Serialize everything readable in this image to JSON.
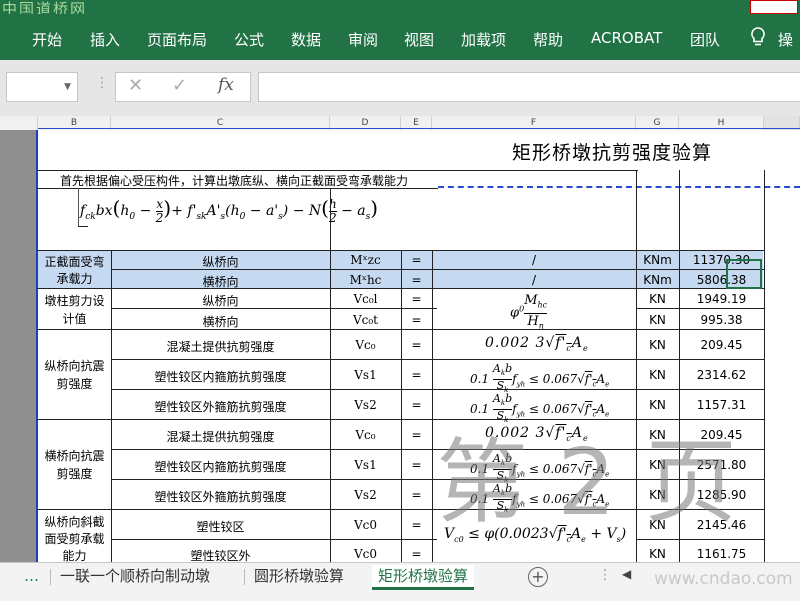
{
  "watermark_top": "中国道桥网",
  "ribbon": {
    "tabs": [
      "开始",
      "插入",
      "页面布局",
      "公式",
      "数据",
      "审阅",
      "视图",
      "加载项",
      "帮助",
      "ACROBAT",
      "团队",
      "操"
    ]
  },
  "formula_bar": {
    "cancel": "✕",
    "confirm": "✓",
    "fx": "fx"
  },
  "columns": [
    "B",
    "C",
    "D",
    "E",
    "F",
    "G",
    "H"
  ],
  "sheet": {
    "title": "矩形桥墩抗剪强度验算",
    "note": "首先根据偏心受压构件，计算出墩底纵、横向正截面受弯承载能力",
    "rows": [
      {
        "group": "正截面受弯承载力",
        "label": "纵桥向",
        "sym": "Mˣzc",
        "eq": "=",
        "f": "/",
        "unit": "KNm",
        "value": "11370.30"
      },
      {
        "group": "",
        "label": "横桥向",
        "sym": "Mˣhc",
        "eq": "=",
        "f": "/",
        "unit": "KNm",
        "value": "5806.38"
      },
      {
        "group": "墩柱剪力设计值",
        "label": "纵桥向",
        "sym": "Vc₀l",
        "eq": "=",
        "f": "",
        "unit": "KN",
        "value": "1949.19"
      },
      {
        "group": "",
        "label": "横桥向",
        "sym": "Vc₀t",
        "eq": "=",
        "f": "",
        "unit": "KN",
        "value": "995.38"
      },
      {
        "group": "纵桥向抗震剪强度",
        "label": "混凝土提供抗剪强度",
        "sym": "Vc₀",
        "eq": "=",
        "f": "",
        "unit": "KN",
        "value": "209.45"
      },
      {
        "group": "",
        "label": "塑性铰区内箍筋抗剪强度",
        "sym": "Vs1",
        "eq": "=",
        "f": "",
        "unit": "KN",
        "value": "2314.62"
      },
      {
        "group": "",
        "label": "塑性铰区外箍筋抗剪强度",
        "sym": "Vs2",
        "eq": "=",
        "f": "",
        "unit": "KN",
        "value": "1157.31"
      },
      {
        "group": "横桥向抗震剪强度",
        "label": "混凝土提供抗剪强度",
        "sym": "Vc₀",
        "eq": "=",
        "f": "",
        "unit": "KN",
        "value": "209.45"
      },
      {
        "group": "",
        "label": "塑性铰区内箍筋抗剪强度",
        "sym": "Vs1",
        "eq": "=",
        "f": "",
        "unit": "KN",
        "value": "2571.80"
      },
      {
        "group": "",
        "label": "塑性铰区外箍筋抗剪强度",
        "sym": "Vs2",
        "eq": "=",
        "f": "",
        "unit": "KN",
        "value": "1285.90"
      },
      {
        "group": "纵桥向斜截面受剪承载能力",
        "label": "塑性铰区",
        "sym": "Vc0",
        "eq": "=",
        "f": "",
        "unit": "KN",
        "value": "2145.46"
      },
      {
        "group": "",
        "label": "塑性铰区外",
        "sym": "Vc0",
        "eq": "=",
        "f": "",
        "unit": "KN",
        "value": "1161.75"
      }
    ],
    "groups": {
      "g1a": "正截面受弯",
      "g1b": "承载力",
      "g2a": "墩柱剪力设",
      "g2b": "计值",
      "g3a": "纵桥向抗震",
      "g3b": "剪强度",
      "g4a": "横桥向抗震",
      "g4b": "剪强度",
      "g5a": "纵桥向斜截",
      "g5b": "面受剪承载",
      "g5c": "能力"
    },
    "formulas": {
      "bending": "f_ck·b·x(h0 − x/2) + f'sk·A's(h0 − a's) − N(h/2 − as)",
      "shear_design": "φ0·Mhc/Hn",
      "concrete": "0.0023√(f'c)·Ae",
      "stirrup": "0.1·(Ak·b/Sk)·fyh ≤ 0.067√(f'c)·Ae",
      "check": "Vc0 ≤ φ(0.0023√(f'c)·Ae + Vs)"
    },
    "watermark_page": "第 2 页"
  },
  "sheet_tabs": {
    "more": "…",
    "tabs": [
      "一联一个顺桥向制动墩",
      "圆形桥墩验算",
      "矩形桥墩验算"
    ],
    "active_index": 2,
    "add": "+"
  },
  "watermark_bottom": "www.cndao.com",
  "colors": {
    "accent": "#217346",
    "highlight": "#c5d9f1",
    "border_blue": "#2a4bd0"
  }
}
